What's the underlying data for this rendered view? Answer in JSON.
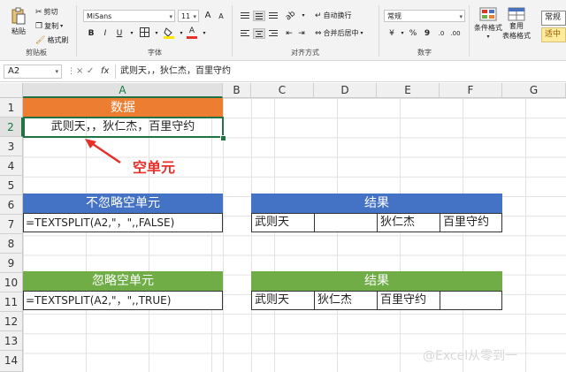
{
  "ribbon": {
    "clipboard": {
      "paste": "粘贴",
      "cut": "剪切",
      "copy": "复制",
      "format_painter": "格式刷",
      "group": "剪贴板"
    },
    "font": {
      "name": "MiSans",
      "size": "11",
      "bold": "B",
      "italic": "I",
      "underline": "U",
      "grow": "A",
      "shrink": "A",
      "font_color_letter": "A",
      "group": "字体"
    },
    "alignment": {
      "wrap": "自动换行",
      "merge": "合并后居中",
      "group": "对齐方式"
    },
    "number": {
      "format": "常规",
      "currency": "¥",
      "percent": "%",
      "comma": "9",
      "group": "数字"
    },
    "styles": {
      "conditional": "条件格式",
      "table_style_line1": "套用",
      "table_style_line2": "表格格式",
      "normal": "常规",
      "neutral": "适中"
    }
  },
  "formula_bar": {
    "name_box": "A2",
    "fx": "fx",
    "cancel": "×",
    "enter": "✓",
    "content": "武则天，，狄仁杰，百里守约"
  },
  "columns": [
    "A",
    "B",
    "C",
    "D",
    "E",
    "F",
    "G"
  ],
  "rows": [
    "1",
    "2",
    "3",
    "4",
    "5",
    "6",
    "7",
    "8",
    "9",
    "10",
    "11",
    "12",
    "13",
    "14"
  ],
  "cells": {
    "a1": "数据",
    "a2": "武则天，，狄仁杰，百里守约",
    "a6": "不忽略空单元",
    "a7": "=TEXTSPLIT(A2,\"，\",,FALSE)",
    "a10": "忽略空单元",
    "a11": "=TEXTSPLIT(A2,\"，\",,TRUE)",
    "result_title_1": "结果",
    "result_row_1": [
      "武则天",
      "",
      "狄仁杰",
      "百里守约"
    ],
    "result_title_2": "结果",
    "result_row_2": [
      "武则天",
      "狄仁杰",
      "百里守约",
      ""
    ]
  },
  "annotation": "空单元",
  "watermark": "@Excel从零到一",
  "colors": {
    "orange": "#ed7d31",
    "blue": "#4472c4",
    "green": "#70ad47",
    "annotation": "#e8302b",
    "selection": "#217346"
  }
}
